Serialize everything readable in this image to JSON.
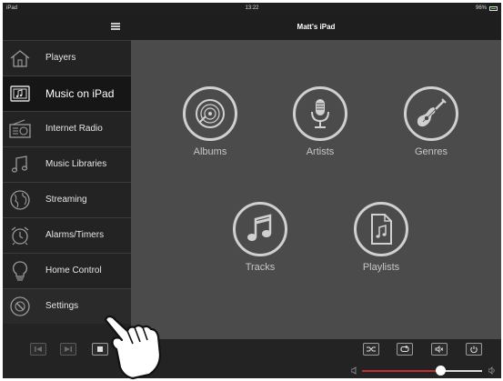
{
  "status": {
    "device": "iPad",
    "time": "13:22",
    "battery": "96%"
  },
  "header": {
    "title": "Matt's iPad"
  },
  "sidebar": {
    "items": [
      {
        "label": "Players",
        "icon": "house-icon"
      },
      {
        "label": "Music on iPad",
        "icon": "music-on-ipad-icon",
        "active": true
      },
      {
        "label": "Internet Radio",
        "icon": "radio-icon"
      },
      {
        "label": "Music Libraries",
        "icon": "music-library-icon"
      },
      {
        "label": "Streaming",
        "icon": "globe-icon"
      },
      {
        "label": "Alarms/Timers",
        "icon": "alarm-clock-icon"
      },
      {
        "label": "Home Control",
        "icon": "lightbulb-icon"
      },
      {
        "label": "Settings",
        "icon": "settings-icon"
      }
    ]
  },
  "main": {
    "tiles": [
      {
        "label": "Albums",
        "icon": "album-disc-icon"
      },
      {
        "label": "Artists",
        "icon": "microphone-icon"
      },
      {
        "label": "Genres",
        "icon": "guitar-icon"
      },
      {
        "label": "Tracks",
        "icon": "music-note-icon"
      },
      {
        "label": "Playlists",
        "icon": "playlist-icon"
      }
    ]
  },
  "playback": {
    "buttons": [
      "previous-icon",
      "next-icon",
      "stop-icon",
      "shuffle-icon",
      "repeat-icon",
      "mute-icon",
      "power-icon"
    ],
    "volume_level": 0.65
  },
  "colors": {
    "background": "#4b4b4b",
    "sidebar": "#232323",
    "active_item": "#161616",
    "volume_accent": "#c03030"
  }
}
